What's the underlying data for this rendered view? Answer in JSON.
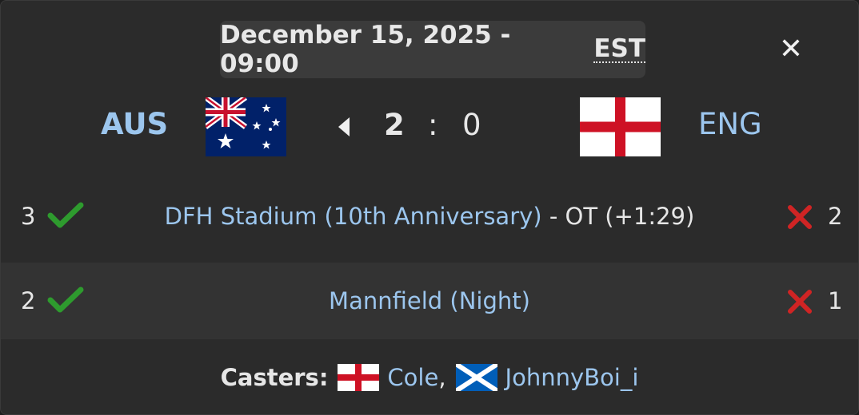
{
  "header": {
    "date_time": "December 15, 2025 - 09:00",
    "timezone": "EST",
    "close_label": "✕"
  },
  "match": {
    "home": {
      "code": "AUS",
      "flag": "australia-flag",
      "score": "2"
    },
    "away": {
      "code": "ENG",
      "flag": "england-flag",
      "score": "0"
    },
    "separator": ":"
  },
  "games": [
    {
      "home_goals": "3",
      "home_result": "check-icon",
      "arena": "DFH Stadium (10th Anniversary)",
      "extra": " - OT (+1:29)",
      "away_result": "cross-icon",
      "away_goals": "2"
    },
    {
      "home_goals": "2",
      "home_result": "check-icon",
      "arena": "Mannfield (Night)",
      "extra": "",
      "away_result": "cross-icon",
      "away_goals": "1"
    }
  ],
  "casters": {
    "label": "Casters:",
    "list": [
      {
        "name": "Cole",
        "flag": "england-flag",
        "sep": ","
      },
      {
        "name": "JohnnyBoi_i",
        "flag": "scotland-flag",
        "sep": ""
      }
    ]
  },
  "colors": {
    "accent_text": "#9cc6ee",
    "win_check": "#2e9b2e",
    "loss_cross": "#d02424",
    "panel_bg": "#2b2b2b",
    "alt_row_bg": "#333333"
  }
}
